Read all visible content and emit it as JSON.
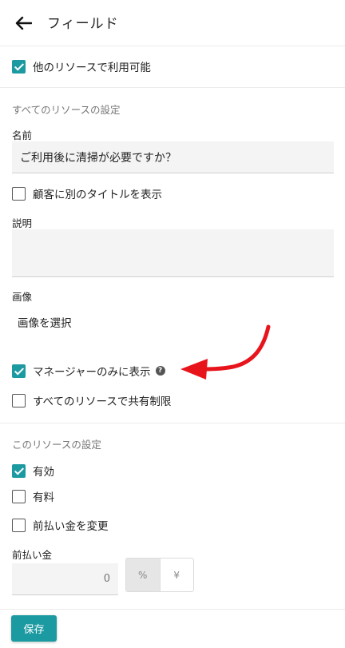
{
  "header": {
    "title": "フィールド"
  },
  "available_other_resources": {
    "label": "他のリソースで利用可能",
    "checked": true
  },
  "all_resources_section": {
    "title": "すべてのリソースの設定",
    "name_label": "名前",
    "name_value": "ご利用後に清掃が必要ですか？",
    "show_other_title": {
      "label": "顧客に別のタイトルを表示",
      "checked": false
    },
    "description_label": "説明",
    "description_value": "",
    "image_label": "画像",
    "select_image": "画像を選択",
    "manager_only": {
      "label": "マネージャーのみに表示",
      "checked": true
    },
    "shared_limit": {
      "label": "すべてのリソースで共有制限",
      "checked": false
    }
  },
  "this_resource_section": {
    "title": "このリソースの設定",
    "enabled": {
      "label": "有効",
      "checked": true
    },
    "paid": {
      "label": "有料",
      "checked": false
    },
    "change_prepayment": {
      "label": "前払い金を変更",
      "checked": false
    },
    "prepayment_label": "前払い金",
    "prepayment_value": "0",
    "unit_options": [
      "%",
      "¥"
    ],
    "unit_selected": "%"
  },
  "save_button": {
    "label": "保存"
  },
  "colors": {
    "accent": "#1c9aa1",
    "annotation_arrow": "#e8141c"
  }
}
